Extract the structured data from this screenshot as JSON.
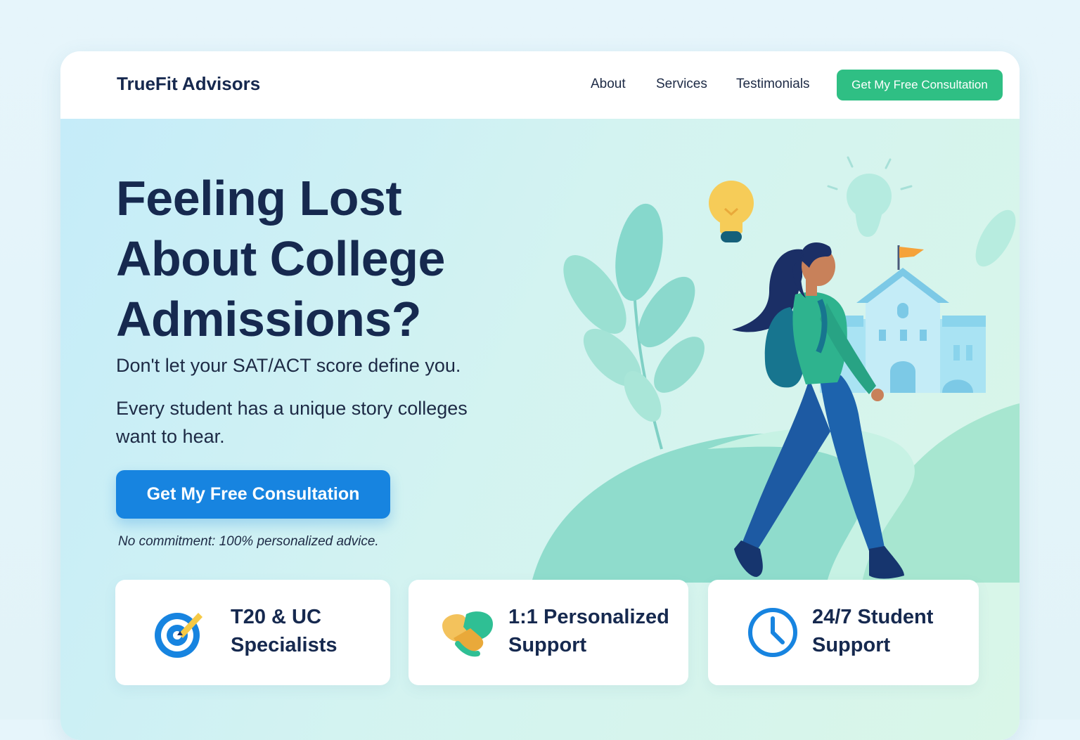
{
  "nav": {
    "brand": "TrueFit Advisors",
    "links": [
      "About",
      "Services",
      "Testimonials"
    ],
    "cta_label": "Get My Free Consultation"
  },
  "hero": {
    "headline_lines": [
      "Feeling Lost",
      "About College",
      "Admissions?"
    ],
    "subheadline": "Don't let your SAT/ACT score define you.",
    "body": "Every student has a unique story colleges want to hear.",
    "cta_label": "Get My Free Consultation",
    "note": "No commitment: 100% personalized advice."
  },
  "features": [
    {
      "icon": "target-icon",
      "line1": "T20 & UC",
      "line2": "Specialists"
    },
    {
      "icon": "handshake-icon",
      "line1": "1:1 Personalized",
      "line2": "Support"
    },
    {
      "icon": "clock-icon",
      "line1": "24/7 Student",
      "line2": "Support"
    }
  ],
  "colors": {
    "navy": "#16294f",
    "primary_blue": "#1784e0",
    "green_cta": "#2fbf84",
    "hero_start": "#c5ecf9",
    "hero_end": "#d9f6e8"
  }
}
